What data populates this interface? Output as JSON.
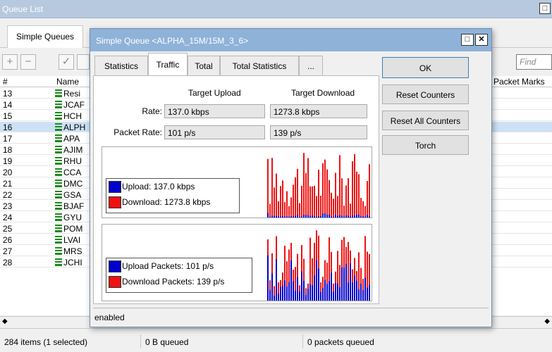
{
  "queue_list": {
    "title": "Queue List",
    "close_glyph": "□",
    "tab": "Simple Queues",
    "find_placeholder": "Find",
    "columns": {
      "num": "#",
      "name": "Name",
      "packet_marks": "Packet Marks"
    },
    "rows": [
      {
        "num": "13",
        "name": "Resi",
        "selected": false
      },
      {
        "num": "14",
        "name": "JCAF",
        "selected": false
      },
      {
        "num": "15",
        "name": "HCH",
        "selected": false
      },
      {
        "num": "16",
        "name": "ALPH",
        "selected": true
      },
      {
        "num": "17",
        "name": "APA",
        "selected": false
      },
      {
        "num": "18",
        "name": "AJIM",
        "selected": false
      },
      {
        "num": "19",
        "name": "RHU",
        "selected": false
      },
      {
        "num": "20",
        "name": "CCA",
        "selected": false
      },
      {
        "num": "21",
        "name": "DMC",
        "selected": false
      },
      {
        "num": "22",
        "name": "GSA",
        "selected": false
      },
      {
        "num": "23",
        "name": "BJAF",
        "selected": false
      },
      {
        "num": "24",
        "name": "GYU",
        "selected": false
      },
      {
        "num": "25",
        "name": "POM",
        "selected": false
      },
      {
        "num": "26",
        "name": "LVAI",
        "selected": false
      },
      {
        "num": "27",
        "name": "MRS",
        "selected": false
      },
      {
        "num": "28",
        "name": "JCHI",
        "selected": false
      }
    ],
    "status": {
      "items": "284 items (1 selected)",
      "queued": "0 B queued",
      "packets": "0 packets queued"
    }
  },
  "dialog": {
    "title": "Simple Queue <ALPHA_15M/15M_3_6>",
    "restore_glyph": "□",
    "close_glyph": "✕",
    "tabs": [
      "Statistics",
      "Traffic",
      "Total",
      "Total Statistics",
      "..."
    ],
    "active_tab": "Traffic",
    "target_upload_header": "Target Upload",
    "target_download_header": "Target Download",
    "rate_label": "Rate:",
    "rate_upload": "137.0 kbps",
    "rate_download": "1273.8 kbps",
    "packet_rate_label": "Packet Rate:",
    "packet_rate_upload": "101 p/s",
    "packet_rate_download": "139 p/s",
    "traffic_legend": {
      "upload": "Upload:  137.0 kbps",
      "download": "Download:  1273.8 kbps"
    },
    "packets_legend": {
      "upload": "Upload Packets:  101 p/s",
      "download": "Download Packets:  139 p/s"
    },
    "colors": {
      "upload": "#0000cc",
      "download": "#ee1111"
    },
    "buttons": {
      "ok": "OK",
      "reset_counters": "Reset Counters",
      "reset_all_counters": "Reset All Counters",
      "torch": "Torch"
    },
    "status": "enabled"
  }
}
